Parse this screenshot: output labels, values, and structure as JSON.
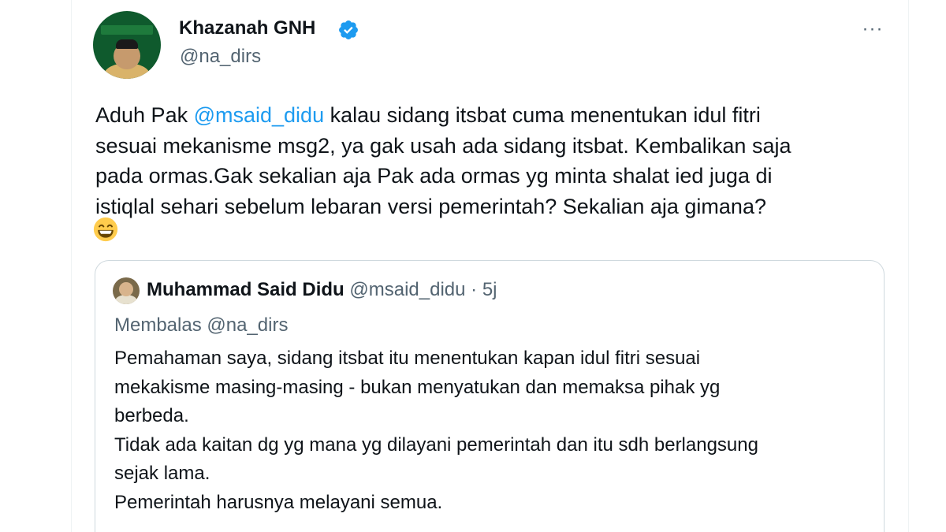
{
  "author": {
    "display_name": "Khazanah GNH",
    "handle": "@na_dirs",
    "verified": true,
    "avatar_icon": "profile-avatar"
  },
  "more_label": "···",
  "tweet": {
    "lines": [
      [
        "Aduh Pak ",
        "@msaid_didu",
        " kalau sidang itsbat cuma menentukan idul fitri"
      ],
      "sesuai mekanisme msg2, ya gak usah ada sidang itsbat. Kembalikan saja",
      "pada ormas.Gak sekalian aja Pak ada ormas yg minta shalat ied juga di",
      "istiqlal sehari sebelum lebaran versi pemerintah? Sekalian aja gimana?"
    ],
    "emoji": "grinning-face-emoji"
  },
  "quoted": {
    "display_name": "Muhammad Said Didu",
    "handle": "@msaid_didu",
    "separator": "·",
    "time": "5j",
    "replying_to": "Membalas @na_dirs",
    "lines": [
      "Pemahaman saya, sidang itsbat itu menentukan kapan idul fitri sesuai",
      "mekakisme masing-masing - bukan menyatukan dan memaksa pihak yg",
      "berbeda.",
      "Tidak ada kaitan dg yg mana yg dilayani pemerintah dan itu sdh berlangsung",
      "sejak lama.",
      "Pemerintah harusnya melayani semua."
    ]
  },
  "colors": {
    "text": "#0f1419",
    "secondary": "#536471",
    "link": "#1d9bf0",
    "border": "#cfd9de"
  }
}
